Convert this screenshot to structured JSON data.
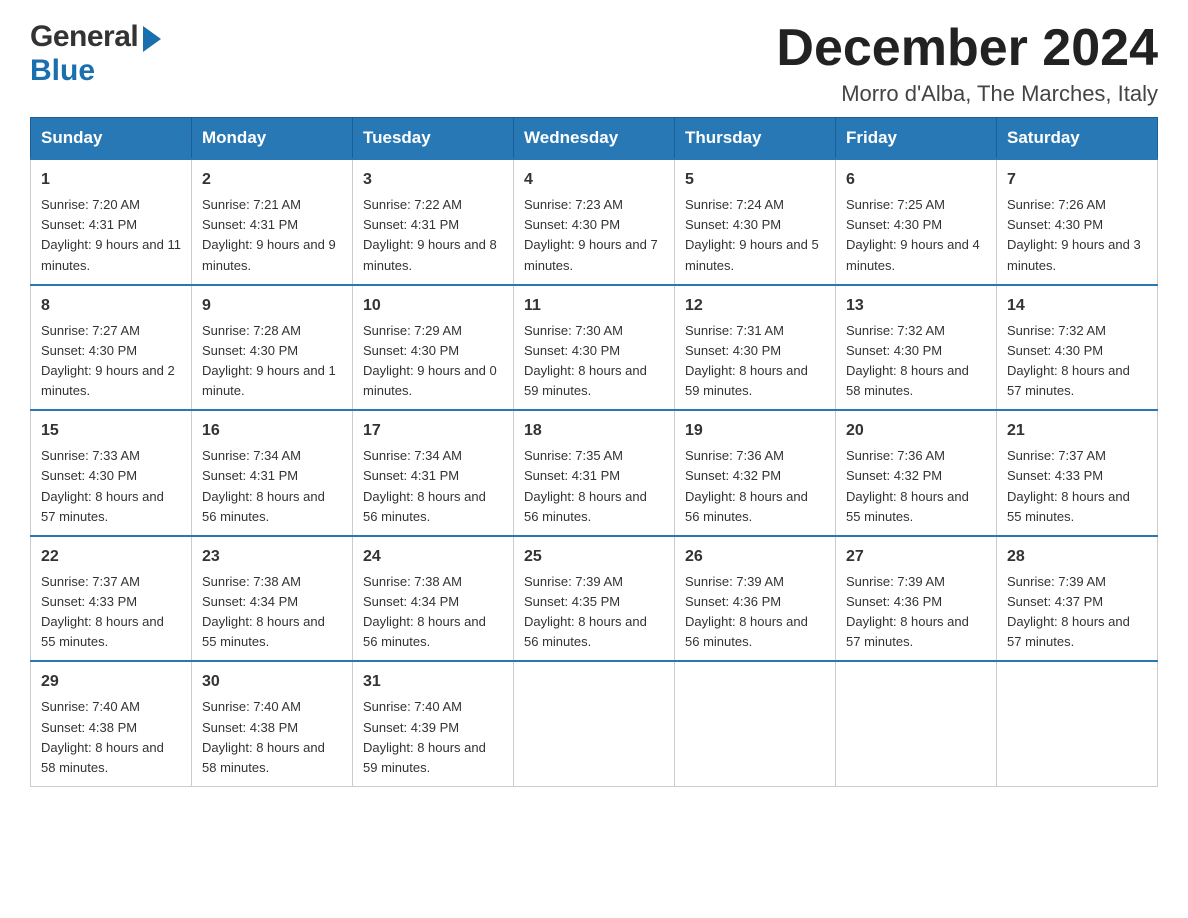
{
  "header": {
    "logo_line1": "General",
    "logo_line2": "Blue",
    "month_title": "December 2024",
    "subtitle": "Morro d'Alba, The Marches, Italy"
  },
  "columns": [
    "Sunday",
    "Monday",
    "Tuesday",
    "Wednesday",
    "Thursday",
    "Friday",
    "Saturday"
  ],
  "weeks": [
    [
      {
        "day": "1",
        "sunrise": "7:20 AM",
        "sunset": "4:31 PM",
        "daylight": "9 hours and 11 minutes."
      },
      {
        "day": "2",
        "sunrise": "7:21 AM",
        "sunset": "4:31 PM",
        "daylight": "9 hours and 9 minutes."
      },
      {
        "day": "3",
        "sunrise": "7:22 AM",
        "sunset": "4:31 PM",
        "daylight": "9 hours and 8 minutes."
      },
      {
        "day": "4",
        "sunrise": "7:23 AM",
        "sunset": "4:30 PM",
        "daylight": "9 hours and 7 minutes."
      },
      {
        "day": "5",
        "sunrise": "7:24 AM",
        "sunset": "4:30 PM",
        "daylight": "9 hours and 5 minutes."
      },
      {
        "day": "6",
        "sunrise": "7:25 AM",
        "sunset": "4:30 PM",
        "daylight": "9 hours and 4 minutes."
      },
      {
        "day": "7",
        "sunrise": "7:26 AM",
        "sunset": "4:30 PM",
        "daylight": "9 hours and 3 minutes."
      }
    ],
    [
      {
        "day": "8",
        "sunrise": "7:27 AM",
        "sunset": "4:30 PM",
        "daylight": "9 hours and 2 minutes."
      },
      {
        "day": "9",
        "sunrise": "7:28 AM",
        "sunset": "4:30 PM",
        "daylight": "9 hours and 1 minute."
      },
      {
        "day": "10",
        "sunrise": "7:29 AM",
        "sunset": "4:30 PM",
        "daylight": "9 hours and 0 minutes."
      },
      {
        "day": "11",
        "sunrise": "7:30 AM",
        "sunset": "4:30 PM",
        "daylight": "8 hours and 59 minutes."
      },
      {
        "day": "12",
        "sunrise": "7:31 AM",
        "sunset": "4:30 PM",
        "daylight": "8 hours and 59 minutes."
      },
      {
        "day": "13",
        "sunrise": "7:32 AM",
        "sunset": "4:30 PM",
        "daylight": "8 hours and 58 minutes."
      },
      {
        "day": "14",
        "sunrise": "7:32 AM",
        "sunset": "4:30 PM",
        "daylight": "8 hours and 57 minutes."
      }
    ],
    [
      {
        "day": "15",
        "sunrise": "7:33 AM",
        "sunset": "4:30 PM",
        "daylight": "8 hours and 57 minutes."
      },
      {
        "day": "16",
        "sunrise": "7:34 AM",
        "sunset": "4:31 PM",
        "daylight": "8 hours and 56 minutes."
      },
      {
        "day": "17",
        "sunrise": "7:34 AM",
        "sunset": "4:31 PM",
        "daylight": "8 hours and 56 minutes."
      },
      {
        "day": "18",
        "sunrise": "7:35 AM",
        "sunset": "4:31 PM",
        "daylight": "8 hours and 56 minutes."
      },
      {
        "day": "19",
        "sunrise": "7:36 AM",
        "sunset": "4:32 PM",
        "daylight": "8 hours and 56 minutes."
      },
      {
        "day": "20",
        "sunrise": "7:36 AM",
        "sunset": "4:32 PM",
        "daylight": "8 hours and 55 minutes."
      },
      {
        "day": "21",
        "sunrise": "7:37 AM",
        "sunset": "4:33 PM",
        "daylight": "8 hours and 55 minutes."
      }
    ],
    [
      {
        "day": "22",
        "sunrise": "7:37 AM",
        "sunset": "4:33 PM",
        "daylight": "8 hours and 55 minutes."
      },
      {
        "day": "23",
        "sunrise": "7:38 AM",
        "sunset": "4:34 PM",
        "daylight": "8 hours and 55 minutes."
      },
      {
        "day": "24",
        "sunrise": "7:38 AM",
        "sunset": "4:34 PM",
        "daylight": "8 hours and 56 minutes."
      },
      {
        "day": "25",
        "sunrise": "7:39 AM",
        "sunset": "4:35 PM",
        "daylight": "8 hours and 56 minutes."
      },
      {
        "day": "26",
        "sunrise": "7:39 AM",
        "sunset": "4:36 PM",
        "daylight": "8 hours and 56 minutes."
      },
      {
        "day": "27",
        "sunrise": "7:39 AM",
        "sunset": "4:36 PM",
        "daylight": "8 hours and 57 minutes."
      },
      {
        "day": "28",
        "sunrise": "7:39 AM",
        "sunset": "4:37 PM",
        "daylight": "8 hours and 57 minutes."
      }
    ],
    [
      {
        "day": "29",
        "sunrise": "7:40 AM",
        "sunset": "4:38 PM",
        "daylight": "8 hours and 58 minutes."
      },
      {
        "day": "30",
        "sunrise": "7:40 AM",
        "sunset": "4:38 PM",
        "daylight": "8 hours and 58 minutes."
      },
      {
        "day": "31",
        "sunrise": "7:40 AM",
        "sunset": "4:39 PM",
        "daylight": "8 hours and 59 minutes."
      },
      null,
      null,
      null,
      null
    ]
  ],
  "labels": {
    "sunrise": "Sunrise:",
    "sunset": "Sunset:",
    "daylight": "Daylight:"
  }
}
